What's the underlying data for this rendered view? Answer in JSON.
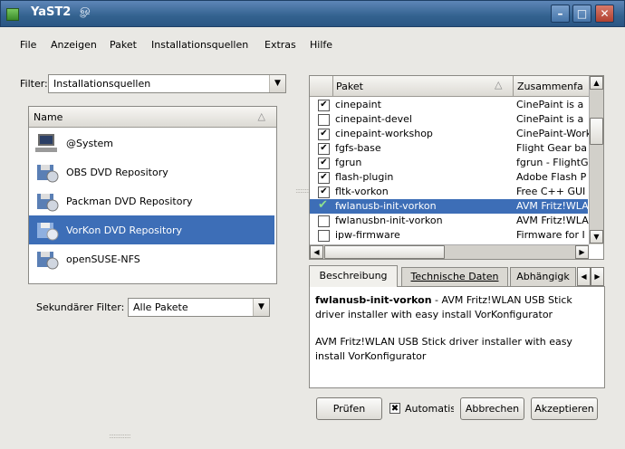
{
  "window": {
    "title": "YaST2",
    "title_swirl": "ௐ",
    "min": "–",
    "max": "□",
    "close": "✕"
  },
  "menu": [
    "File",
    "Anzeigen",
    "Paket",
    "Installationsquellen",
    "Extras",
    "Hilfe"
  ],
  "filter": {
    "label": "Filter:",
    "value": "Installationsquellen"
  },
  "repos": {
    "header": "Name",
    "items": [
      "@System",
      "OBS DVD Repository",
      "Packman DVD Repository",
      "VorKon DVD Repository",
      "openSUSE-NFS"
    ],
    "selected": 3
  },
  "secondary_filter": {
    "label": "Sekundärer Filter:",
    "value": "Alle Pakete"
  },
  "packages": {
    "headers": {
      "package": "Paket",
      "summary": "Zusammenfa"
    },
    "rows": [
      {
        "name": "cinepaint",
        "summary": "CinePaint is a",
        "checked": "✔"
      },
      {
        "name": "cinepaint-devel",
        "summary": "CinePaint is a",
        "checked": ""
      },
      {
        "name": "cinepaint-workshop",
        "summary": "CinePaint-Work",
        "checked": "✔"
      },
      {
        "name": "fgfs-base",
        "summary": "Flight Gear ba",
        "checked": "✔"
      },
      {
        "name": "fgrun",
        "summary": "fgrun - FlightG",
        "checked": "✔"
      },
      {
        "name": "flash-plugin",
        "summary": "Adobe Flash P",
        "checked": "✔"
      },
      {
        "name": "fltk-vorkon",
        "summary": "Free C++ GUI",
        "checked": "✔"
      },
      {
        "name": "fwlanusb-init-vorkon",
        "summary": "AVM Fritz!WLAN",
        "checked": "✔"
      },
      {
        "name": "fwlanusbn-init-vorkon",
        "summary": "AVM Fritz!WLAN",
        "checked": ""
      },
      {
        "name": "ipw-firmware",
        "summary": "Firmware for I",
        "checked": ""
      }
    ],
    "selected": 7
  },
  "tabs": [
    "Beschreibung",
    "Technische Daten",
    "Abhängigk"
  ],
  "description": {
    "name": "fwlanusb-init-vorkon",
    "short": " - AVM Fritz!WLAN USB Stick driver installer with easy install VorKonfigurator",
    "long": "AVM Fritz!WLAN USB Stick driver installer with easy install VorKonfigurator"
  },
  "buttons": {
    "check": "Prüfen",
    "auto": "Automatis",
    "auto_checked": "✖",
    "cancel": "Abbrechen",
    "accept": "Akzeptieren"
  },
  "glyphs": {
    "down": "▼",
    "up": "▲",
    "left": "◀",
    "right": "▶",
    "sort": "△",
    "grip": "::::::::::::::"
  },
  "colors": {
    "selection": "#3d6eb7",
    "titlebar": "#33628f"
  }
}
